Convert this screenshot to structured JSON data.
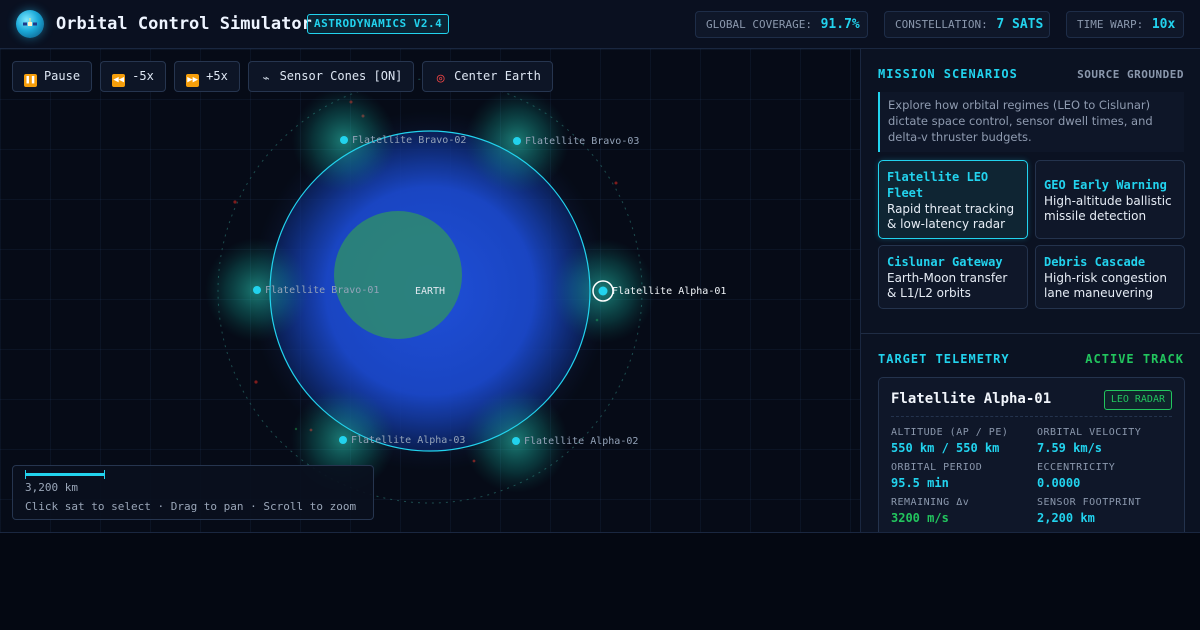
{
  "header": {
    "title": "Orbital Control Simulator",
    "version": "ASTRODYNAMICS V2.4",
    "stats": {
      "coverage_label": "GLOBAL COVERAGE:",
      "coverage_value": "91.7%",
      "constellation_label": "CONSTELLATION:",
      "constellation_value": "7 SATS",
      "warp_label": "TIME WARP:",
      "warp_value": "10x"
    }
  },
  "toolbar": {
    "pause": "Pause",
    "slower": "-5x",
    "faster": "+5x",
    "cones": "Sensor Cones [ON]",
    "center": "Center Earth"
  },
  "scene": {
    "earth_label": "EARTH",
    "selected": "Flatellite Alpha-01",
    "satellites": [
      {
        "name": "Flatellite Alpha-01"
      },
      {
        "name": "Flatellite Alpha-02"
      },
      {
        "name": "Flatellite Alpha-03"
      },
      {
        "name": "Flatellite Bravo-01"
      },
      {
        "name": "Flatellite Bravo-02"
      },
      {
        "name": "Flatellite Bravo-03"
      }
    ]
  },
  "scale": {
    "label": "3,200 km",
    "hint": "Click sat to select · Drag to pan · Scroll to zoom"
  },
  "mission": {
    "title": "MISSION SCENARIOS",
    "tag": "SOURCE GROUNDED",
    "description": "Explore how orbital regimes (LEO to Cislunar) dictate space control, sensor dwell times, and delta-v thruster budgets.",
    "scenarios": [
      {
        "title": "Flatellite LEO Fleet",
        "desc": "Rapid threat tracking & low-latency radar"
      },
      {
        "title": "GEO Early Warning",
        "desc": "High-altitude ballistic missile detection"
      },
      {
        "title": "Cislunar Gateway",
        "desc": "Earth-Moon transfer & L1/L2 orbits"
      },
      {
        "title": "Debris Cascade",
        "desc": "High-risk congestion lane maneuvering"
      }
    ]
  },
  "telemetry": {
    "title": "TARGET TELEMETRY",
    "status": "ACTIVE TRACK",
    "name": "Flatellite Alpha-01",
    "badge": "LEO RADAR",
    "fields": [
      {
        "label": "ALTITUDE (AP / PE)",
        "value": "550 km / 550 km"
      },
      {
        "label": "ORBITAL VELOCITY",
        "value": "7.59 km/s"
      },
      {
        "label": "ORBITAL PERIOD",
        "value": "95.5 min"
      },
      {
        "label": "ECCENTRICITY",
        "value": "0.0000"
      },
      {
        "label": "REMAINING Δv",
        "value": "3200 m/s"
      },
      {
        "label": "SENSOR FOOTPRINT",
        "value": "2,200 km"
      }
    ]
  },
  "colors": {
    "accent": "#22d3ee",
    "positive": "#22c55e",
    "background": "#050913"
  }
}
